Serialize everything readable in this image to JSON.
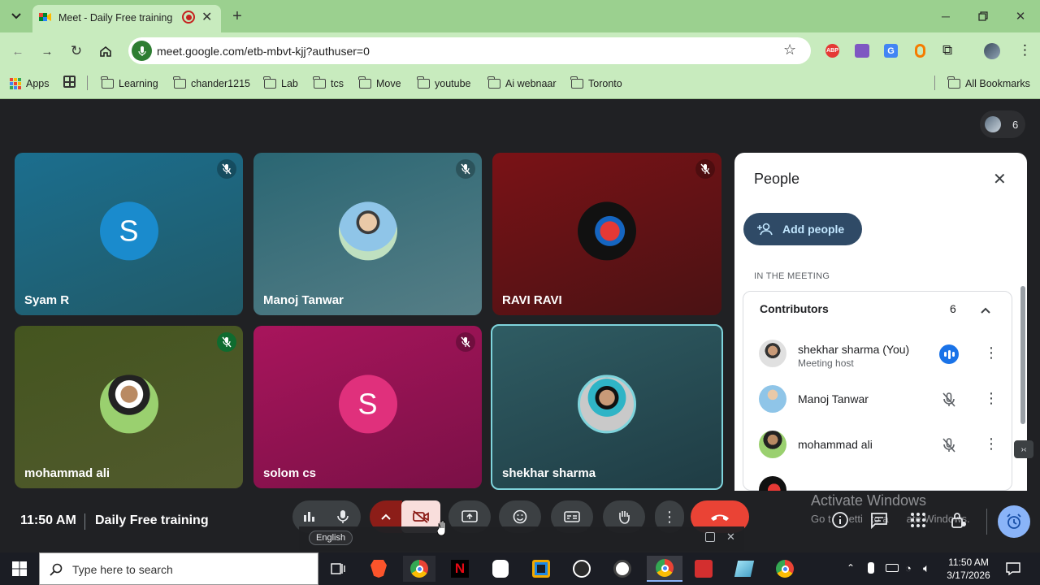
{
  "browser": {
    "tab_title": "Meet - Daily Free training",
    "url": "meet.google.com/etb-mbvt-kjj?authuser=0",
    "bookmarks": [
      "Apps",
      "Learning",
      "chander1215",
      "Lab",
      "tcs",
      "Move",
      "youtube",
      "Ai webnaar",
      "Toronto"
    ],
    "all_bookmarks": "All Bookmarks"
  },
  "meet": {
    "participant_count": "6",
    "tiles": [
      {
        "name": "Syam R",
        "initial": "S"
      },
      {
        "name": "Manoj Tanwar"
      },
      {
        "name": "RAVI RAVI"
      },
      {
        "name": "mohammad ali"
      },
      {
        "name": "solom cs",
        "initial": "S"
      },
      {
        "name": "shekhar sharma"
      }
    ],
    "time": "11:50 AM",
    "meeting_title": "Daily Free training",
    "caption_language": "English"
  },
  "people_panel": {
    "title": "People",
    "add_people": "Add people",
    "section_label": "IN THE MEETING",
    "group_label": "Contributors",
    "group_count": "6",
    "participants": [
      {
        "name": "shekhar sharma (You)",
        "role": "Meeting host"
      },
      {
        "name": "Manoj Tanwar"
      },
      {
        "name": "mohammad ali"
      }
    ]
  },
  "overlay": {
    "activate_title": "Activate Windows",
    "activate_sub_a": "Go t",
    "activate_sub_b": "etti",
    "activate_sub_c": "to a",
    "activate_sub_d": "ate Windows."
  },
  "taskbar": {
    "search_placeholder": "Type here to search",
    "clock_time": "11:50 AM",
    "clock_date": "3/17/2026"
  },
  "colors": {
    "accent": "#8ab4f8",
    "end_call": "#ea4335",
    "chrome_green": "#c8ebbe"
  }
}
